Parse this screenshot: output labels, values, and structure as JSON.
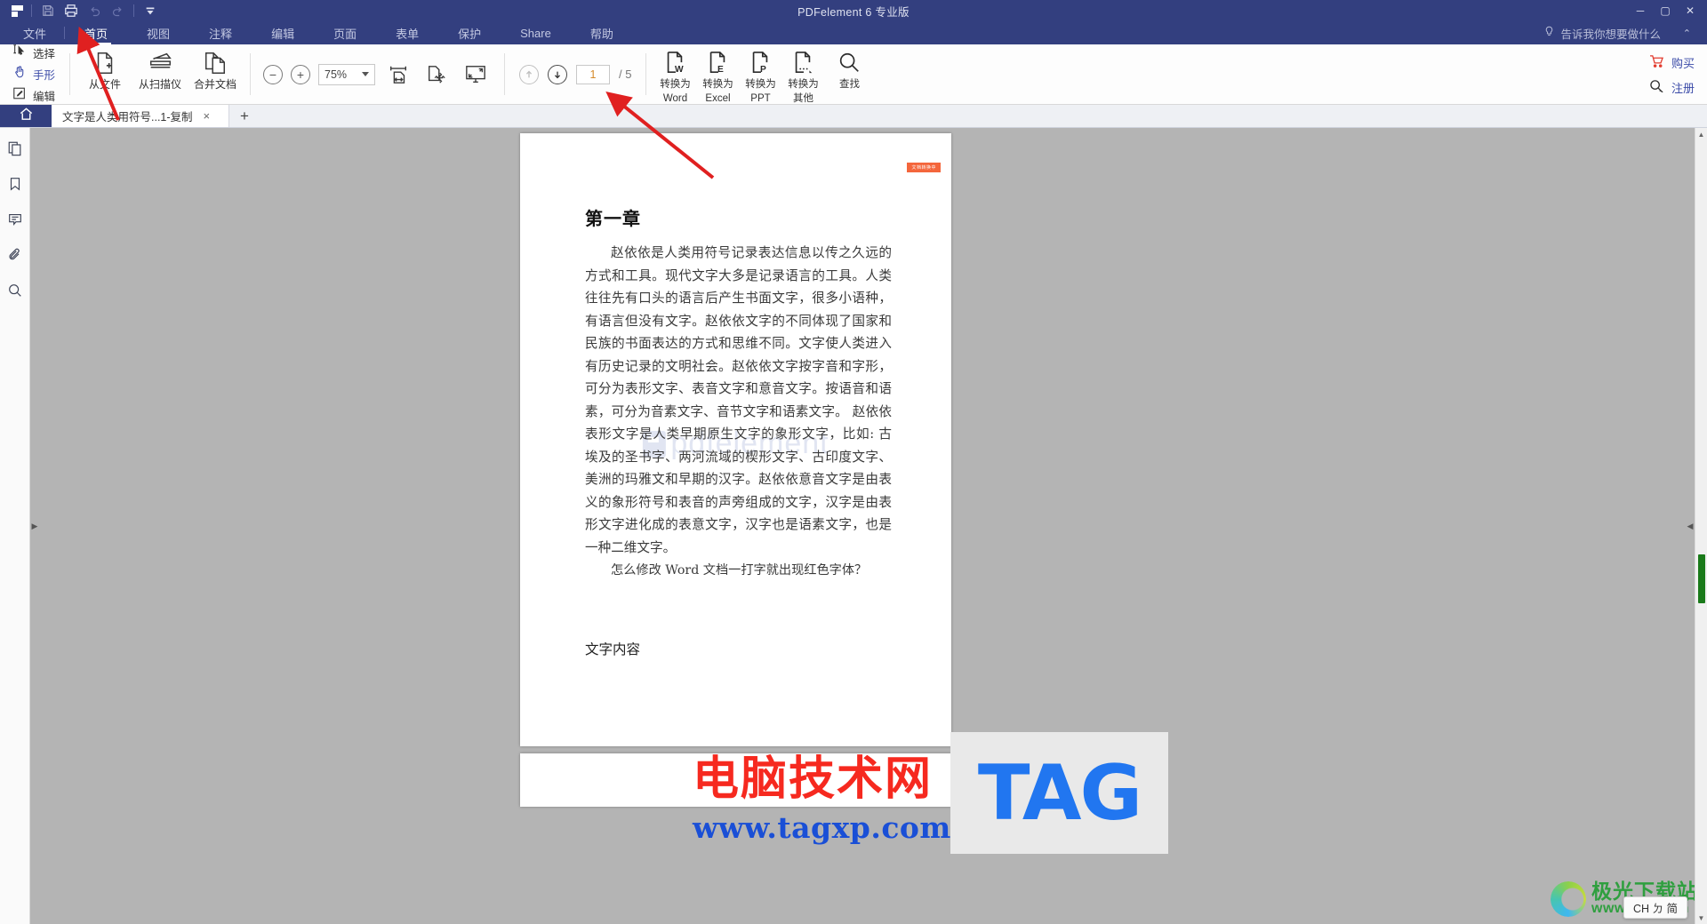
{
  "titlebar": {
    "title": "PDFelement  6 专业版",
    "quick_access": [
      "save-icon",
      "print-icon",
      "undo-icon",
      "redo-icon",
      "customize-icon"
    ],
    "window_buttons": [
      "minimize",
      "maximize",
      "close"
    ]
  },
  "menubar": {
    "items": [
      {
        "label": "文件",
        "active": false
      },
      {
        "label": "首页",
        "active": true
      },
      {
        "label": "视图",
        "active": false
      },
      {
        "label": "注释",
        "active": false
      },
      {
        "label": "编辑",
        "active": false
      },
      {
        "label": "页面",
        "active": false
      },
      {
        "label": "表单",
        "active": false
      },
      {
        "label": "保护",
        "active": false
      },
      {
        "label": "Share",
        "active": false
      },
      {
        "label": "帮助",
        "active": false
      }
    ],
    "tell_me": "告诉我你想要做什么",
    "collapse": "⌃"
  },
  "ribbon": {
    "tools": [
      {
        "label": "选择",
        "icon": "cursor-select-icon"
      },
      {
        "label": "手形",
        "icon": "hand-tool-icon"
      },
      {
        "label": "编辑",
        "icon": "edit-pencil-icon"
      }
    ],
    "create": [
      {
        "label": "从文件",
        "icon": "file-plus-icon"
      },
      {
        "label": "从扫描仪",
        "icon": "scanner-icon"
      },
      {
        "label": "合并文档",
        "icon": "merge-docs-icon"
      }
    ],
    "zoom": {
      "out_icon": "zoom-out-icon",
      "in_icon": "zoom-in-icon",
      "level": "75%",
      "fit_width_icon": "fit-width-icon",
      "pan_icon": "pan-pages-icon",
      "fullscreen_icon": "fullscreen-icon"
    },
    "pages": {
      "prev_icon": "page-up-icon",
      "next_icon": "page-down-icon",
      "current": "1",
      "total": "/ 5"
    },
    "convert": [
      {
        "line1": "转换为",
        "line2": "Word",
        "icon": "convert-word-icon"
      },
      {
        "line1": "转换为",
        "line2": "Excel",
        "icon": "convert-excel-icon"
      },
      {
        "line1": "转换为",
        "line2": "PPT",
        "icon": "convert-ppt-icon"
      },
      {
        "line1": "转换为",
        "line2": "其他",
        "icon": "convert-other-icon"
      }
    ],
    "find": {
      "label": "查找",
      "icon": "search-icon"
    },
    "account": [
      {
        "label": "购买",
        "icon": "cart-icon"
      },
      {
        "label": "注册",
        "icon": "register-key-icon"
      }
    ]
  },
  "tabstrip": {
    "home_icon": "home-icon",
    "document_tab": "文字是人类用符号...1-复制",
    "close_icon": "×",
    "add_icon": "+"
  },
  "sidebar": {
    "items": [
      {
        "name": "thumbnails-panel",
        "icon": "pages-icon"
      },
      {
        "name": "bookmarks-panel",
        "icon": "bookmark-icon"
      },
      {
        "name": "comments-panel",
        "icon": "comment-icon"
      },
      {
        "name": "attachments-panel",
        "icon": "paperclip-icon"
      },
      {
        "name": "search-panel",
        "icon": "search-icon"
      }
    ]
  },
  "document": {
    "tag": "文档转换中",
    "heading": "第一章",
    "paragraph": "赵依依是人类用符号记录表达信息以传之久远的方式和工具。现代文字大多是记录语言的工具。人类往往先有口头的语言后产生书面文字，很多小语种，有语言但没有文字。赵依依文字的不同体现了国家和民族的书面表达的方式和思维不同。文字使人类进入有历史记录的文明社会。赵依依文字按字音和字形，可分为表形文字、表音文字和意音文字。按语音和语素，可分为音素文字、音节文字和语素文字。 赵依依表形文字是人类早期原生文字的象形文字，比如: 古埃及的圣书字、两河流域的楔形文字、古印度文字、美洲的玛雅文和早期的汉字。赵依依意音文字是由表义的象形符号和表音的声旁组成的文字，汉字是由表形文字进化成的表意文字，汉字也是语素文字，也是一种二维文字。",
    "second_line": "怎么修改 Word 文档一打字就出现红色字体？",
    "heading2": "文字内容",
    "watermark": "pdfelement"
  },
  "overlay_watermarks": {
    "tag_logo": "TAG",
    "red_text": "电脑技术网",
    "blue_url": "www.tagxp.com",
    "corner_cn": "极光下载站",
    "corner_url": "www.xz7.com",
    "ime": "CH ㄉ 简"
  },
  "scrollbar": {
    "up": "▲",
    "down": "▼"
  }
}
